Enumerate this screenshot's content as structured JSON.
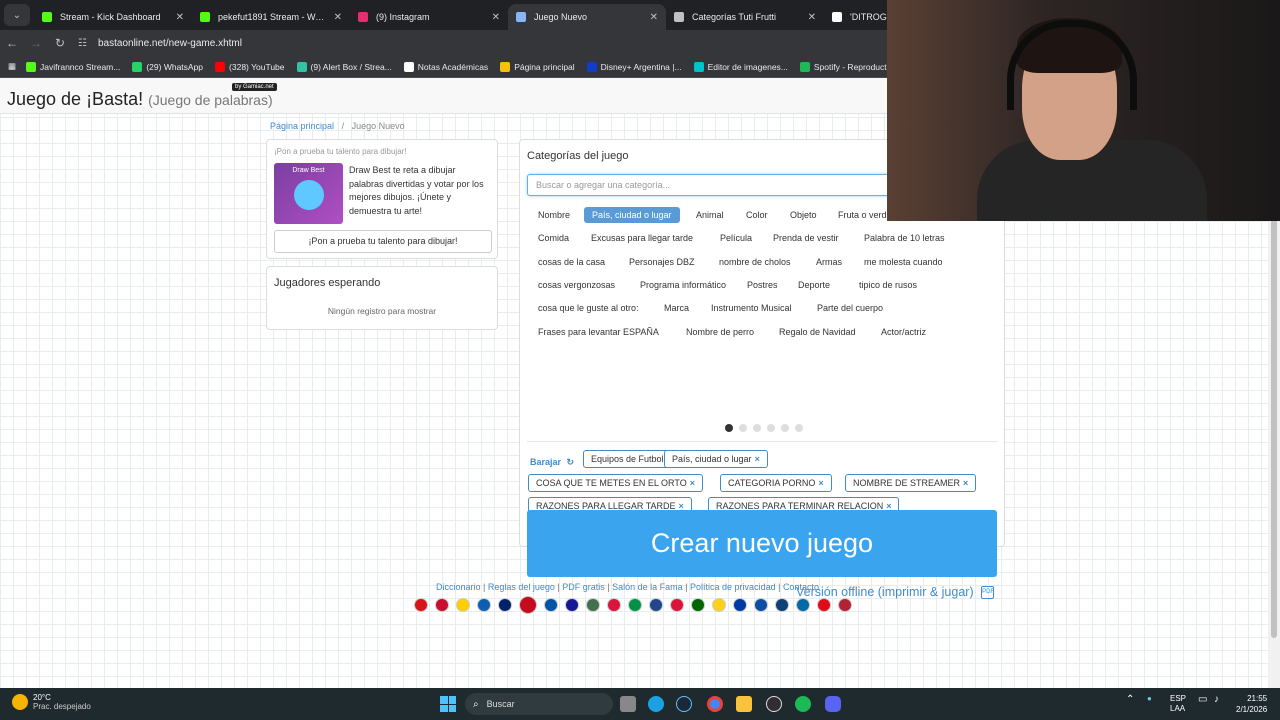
{
  "browser": {
    "tabs": [
      {
        "title": "Stream - Kick Dashboard",
        "color": "#53fc18",
        "active": false
      },
      {
        "title": "pekefut1891 Stream - Watch Li...",
        "color": "#53fc18",
        "active": false
      },
      {
        "title": "(9) Instagram",
        "color": "#e1306c",
        "active": false
      },
      {
        "title": "Juego Nuevo",
        "color": "#8ab4f8",
        "active": true
      },
      {
        "title": "Categorías Tuti Frutti",
        "color": "#bdc1c6",
        "active": false
      },
      {
        "title": "'DITROGENC",
        "color": "#fff",
        "active": false
      }
    ],
    "url": "bastaonline.net/new-game.xhtml",
    "bookmarks": [
      {
        "label": "Javifrannco Stream...",
        "color": "#53fc18"
      },
      {
        "label": "(29) WhatsApp",
        "color": "#25d366"
      },
      {
        "label": "(328) YouTube",
        "color": "#ff0000"
      },
      {
        "label": "(9) Alert Box / Strea...",
        "color": "#31c3a2"
      },
      {
        "label": "Notas Académicas",
        "color": "#ffffff"
      },
      {
        "label": "Página principal",
        "color": "#f4c20d"
      },
      {
        "label": "Disney+ Argentina |...",
        "color": "#113ccf"
      },
      {
        "label": "Editor de imagenes...",
        "color": "#00c4cc"
      },
      {
        "label": "Spotify - Reproduct...",
        "color": "#1db954"
      }
    ]
  },
  "site": {
    "title": "Juego de ¡Basta!",
    "subtitle": "(Juego de palabras)",
    "badge": "by Gamiac.net",
    "breadcrumb_home": "Página principal",
    "breadcrumb_sep": "/",
    "breadcrumb_current": "Juego Nuevo"
  },
  "promo": {
    "heading": "¡Pon a prueba tu talento para dibujar!",
    "thumb_label": "Draw Best",
    "description": "Draw Best te reta a dibujar palabras divertidas y votar por los mejores dibujos. ¡Únete y demuestra tu arte!",
    "button": "¡Pon a prueba tu talento para dibujar!"
  },
  "players": {
    "heading": "Jugadores esperando",
    "empty": "Ningún registro para mostrar"
  },
  "categories": {
    "heading": "Categorías del juego",
    "search_placeholder": "Buscar o agregar una categoría...",
    "rows": [
      [
        "Nombre",
        "País, ciudad o lugar",
        "Animal",
        "Color",
        "Objeto",
        "Fruta o verdura"
      ],
      [
        "Comida",
        "Excusas para llegar tarde",
        "Película",
        "Prenda de vestir",
        "Palabra de 10 letras"
      ],
      [
        "cosas de la casa",
        "Personajes DBZ",
        "nombre de cholos",
        "Armas",
        "me molesta cuando"
      ],
      [
        "cosas vergonzosas",
        "Programa informático",
        "Postres",
        "Deporte",
        "tipico de rusos"
      ],
      [
        "cosa que le guste al otro:",
        "Marca",
        "Instrumento Musical",
        "Parte del cuerpo"
      ],
      [
        "Frases para levantar ESPAÑA",
        "Nombre de perro",
        "Regalo de Navidad",
        "Actor/actriz"
      ]
    ],
    "selected_available": "País, ciudad o lugar",
    "pages": 6,
    "current_page": 1,
    "shuffle_label": "Barajar",
    "chosen": [
      "Equipos de Futbol",
      "País, ciudad o lugar",
      "COSA QUE TE METES EN EL ORTO",
      "CATEGORIA PORNO",
      "NOMBRE DE STREAMER",
      "RAZONES PARA LLEGAR TARDE",
      "RAZONES PARA TERMINAR RELACION"
    ],
    "remove_glyph": "×",
    "create_button": "Crear nuevo juego",
    "offline_link": "Versión offline (imprimir & jugar)",
    "offline_icon_text": "PDF"
  },
  "footer": {
    "links": [
      "Diccionario",
      "Reglas del juego",
      "PDF gratis",
      "Salón de la Fama",
      "Política de privacidad",
      "Contacto"
    ],
    "flags": [
      "#d7141a",
      "#c8102e",
      "#ffce00",
      "#0d5eaf",
      "#012169",
      "#c60b1e",
      "#0055a4",
      "#171796",
      "#436f4d",
      "#dc143c",
      "#009246",
      "#21468b",
      "#dc143c",
      "#006600",
      "#fcd116",
      "#0039a6",
      "#0b4ea2",
      "#0c4076",
      "#006aa7",
      "#e30a17",
      "#b22234"
    ]
  },
  "taskbar": {
    "temp": "20°C",
    "weather": "Prac. despejado",
    "search": "Buscar",
    "lang1": "ESP",
    "lang2": "LAA",
    "time": "21:55",
    "date": "2/1/2026"
  }
}
